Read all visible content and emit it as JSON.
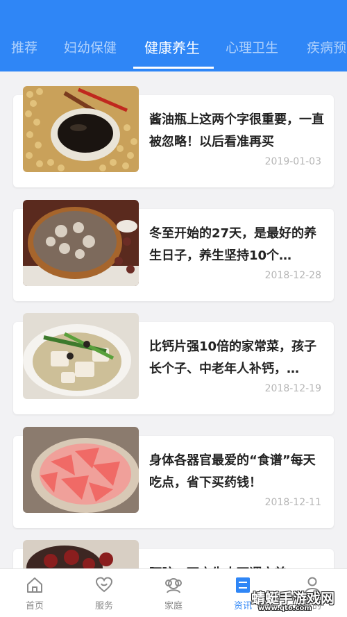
{
  "tabs": [
    {
      "label": "推荐"
    },
    {
      "label": "妇幼保健"
    },
    {
      "label": "健康养生"
    },
    {
      "label": "心理卫生"
    },
    {
      "label": "疾病预"
    }
  ],
  "active_tab": "健康养生",
  "articles": [
    {
      "title": "酱油瓶上这两个字很重要，一直被忽略！以后看准再买",
      "date": "2019-01-03"
    },
    {
      "title": "冬至开始的27天，是最好的养生日子，养生坚持10个…",
      "date": "2018-12-28"
    },
    {
      "title": "比钙片强10倍的家常菜，孩子长个子、中老年人补钙，…",
      "date": "2018-12-19"
    },
    {
      "title": "身体各器官最爱的“食谱”每天吃点，省下买药钱！",
      "date": "2018-12-11"
    },
    {
      "title": "阿胶，西方生人可谓方美",
      "date": ""
    }
  ],
  "bottom_nav": [
    {
      "label": "首页",
      "icon": "home-icon"
    },
    {
      "label": "服务",
      "icon": "heart-icon"
    },
    {
      "label": "家庭",
      "icon": "family-icon"
    },
    {
      "label": "资讯",
      "icon": "news-icon"
    },
    {
      "label": "我的",
      "icon": "user-icon"
    }
  ],
  "watermark": {
    "title": "蜻蜓手游戏网",
    "url": "www.qt6.com"
  },
  "colors": {
    "primary": "#2f86f6",
    "background": "#f2f2f4",
    "date_text": "#b5b5b5"
  }
}
